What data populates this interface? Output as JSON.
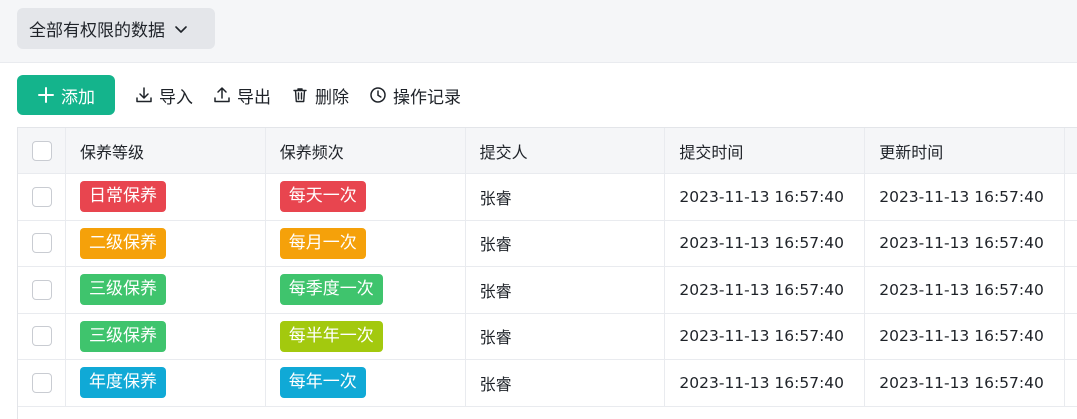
{
  "scope": {
    "label": "全部有权限的数据",
    "icon": "chevron-down-icon"
  },
  "toolbar": {
    "add_label": "添加",
    "import_label": "导入",
    "export_label": "导出",
    "delete_label": "删除",
    "log_label": "操作记录"
  },
  "table": {
    "columns": [
      "保养等级",
      "保养频次",
      "提交人",
      "提交时间",
      "更新时间"
    ],
    "rows": [
      {
        "level": "日常保养",
        "level_color": "#e8454f",
        "freq": "每天一次",
        "freq_color": "#e8454f",
        "submitter": "张睿",
        "submitted": "2023-11-13 16:57:40",
        "updated": "2023-11-13 16:57:40"
      },
      {
        "level": "二级保养",
        "level_color": "#f5a10a",
        "freq": "每月一次",
        "freq_color": "#f5a10a",
        "submitter": "张睿",
        "submitted": "2023-11-13 16:57:40",
        "updated": "2023-11-13 16:57:40"
      },
      {
        "level": "三级保养",
        "level_color": "#3fc46d",
        "freq": "每季度一次",
        "freq_color": "#3fc46d",
        "submitter": "张睿",
        "submitted": "2023-11-13 16:57:40",
        "updated": "2023-11-13 16:57:40"
      },
      {
        "level": "三级保养",
        "level_color": "#3fc46d",
        "freq": "每半年一次",
        "freq_color": "#a3c90e",
        "submitter": "张睿",
        "submitted": "2023-11-13 16:57:40",
        "updated": "2023-11-13 16:57:40"
      },
      {
        "level": "年度保养",
        "level_color": "#10a9d6",
        "freq": "每年一次",
        "freq_color": "#10a9d6",
        "submitter": "张睿",
        "submitted": "2023-11-13 16:57:40",
        "updated": "2023-11-13 16:57:40"
      }
    ]
  },
  "colors": {
    "accent": "#14b48c"
  }
}
